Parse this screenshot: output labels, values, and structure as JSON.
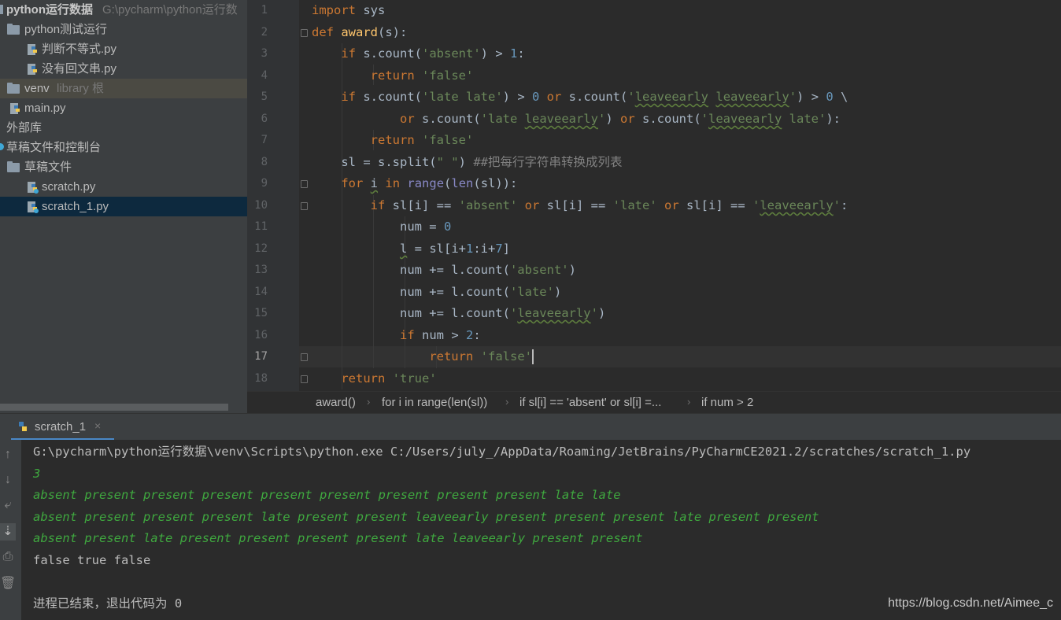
{
  "project": {
    "root_name": "python运行数据",
    "root_path": "G:\\pycharm\\python运行数",
    "items": [
      {
        "label": "python测试运行",
        "type": "folder"
      },
      {
        "label": "判断不等式.py",
        "type": "file"
      },
      {
        "label": "没有回文串.py",
        "type": "file"
      },
      {
        "label": "venv",
        "hint": "library 根",
        "type": "folder"
      },
      {
        "label": "main.py",
        "type": "file"
      },
      {
        "label": "外部库",
        "type": "group"
      },
      {
        "label": "草稿文件和控制台",
        "type": "group"
      },
      {
        "label": "草稿文件",
        "type": "folder"
      },
      {
        "label": "scratch.py",
        "type": "file"
      },
      {
        "label": "scratch_1.py",
        "type": "file",
        "selected": true
      }
    ]
  },
  "editor": {
    "current_line": 17,
    "line_numbers": [
      "1",
      "2",
      "3",
      "4",
      "5",
      "6",
      "7",
      "8",
      "9",
      "10",
      "11",
      "12",
      "13",
      "14",
      "15",
      "16",
      "17",
      "18"
    ],
    "lines": [
      "import sys",
      "def award(s):",
      "    if s.count('absent') > 1:",
      "        return 'false'",
      "    if s.count('late late') > 0 or s.count('leaveearly leaveearly') > 0 \\",
      "            or s.count('late leaveearly') or s.count('leaveearly late'):",
      "        return 'false'",
      "    sl = s.split(\" \") ##把每行字符串转换成列表",
      "    for i in range(len(sl)):",
      "        if sl[i] == 'absent' or sl[i] == 'late' or sl[i] == 'leaveearly':",
      "            num = 0",
      "            l = sl[i+1:i+7]",
      "            num += l.count('absent')",
      "            num += l.count('late')",
      "            num += l.count('leaveearly')",
      "            if num > 2:",
      "                return 'false'",
      "    return 'true'"
    ]
  },
  "breadcrumbs": [
    "award()",
    "for i in range(len(sl))",
    "if sl[i] == 'absent' or sl[i] =...",
    "if num > 2"
  ],
  "run": {
    "tab_label": "scratch_1",
    "close_glyph": "×",
    "output": [
      {
        "text": "G:\\pycharm\\python运行数据\\venv\\Scripts\\python.exe C:/Users/july_/AppData/Roaming/JetBrains/PyCharmCE2021.2/scratches/scratch_1.py",
        "style": "normal"
      },
      {
        "text": "3",
        "style": "green"
      },
      {
        "text": "absent present present present present present present present present late late",
        "style": "green"
      },
      {
        "text": "absent present present present late present present leaveearly present present present late present present",
        "style": "green"
      },
      {
        "text": "absent present late present present present present late leaveearly present present",
        "style": "green"
      },
      {
        "text": "false true false",
        "style": "normal"
      },
      {
        "text": "",
        "style": "normal"
      },
      {
        "text": "进程已结束，退出代码为 0",
        "style": "normal"
      }
    ]
  },
  "watermark": "https://blog.csdn.net/Aimee_c",
  "icons": [
    "folder-icon",
    "python-file-icon",
    "scratch-file-icon",
    "console-icon",
    "arrow-up-icon",
    "arrow-down-icon",
    "soft-wrap-icon",
    "scroll-to-end-icon",
    "print-icon",
    "trash-icon"
  ]
}
